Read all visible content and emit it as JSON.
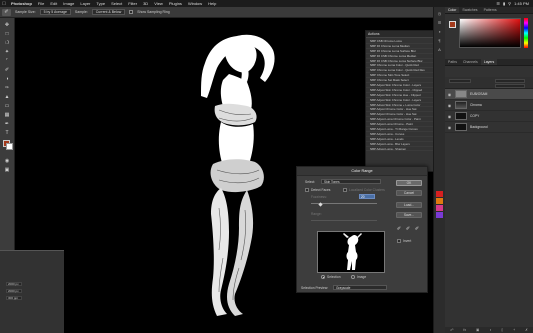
{
  "menubar": {
    "app": "Photoshop",
    "items": [
      "File",
      "Edit",
      "Image",
      "Layer",
      "Type",
      "Select",
      "Filter",
      "3D",
      "View",
      "Plugins",
      "Window",
      "Help"
    ],
    "time": "1:45 PM"
  },
  "options": {
    "sample_size_label": "Sample Size:",
    "sample_size": "5 by 5 Average",
    "sample_label": "Sample:",
    "sample": "Current & Below",
    "show_ring": "Show Sampling Ring"
  },
  "actions": {
    "title": "Actions",
    "items": [
      "NBP CSB Chrome Luma",
      "NBP F6 Chrome Luma Median",
      "NBP F6 Chrome Luma Surface Blur",
      "NBP F6 CSB Chrome Luma Median",
      "NBP F6 CSB Chrome Luma Surface Blur",
      "NBP Chrome Luma Color - Quick Red",
      "NBP Chrome Luma Color - Quick Red Res",
      "NBP Chrome Skin Tone Select",
      "NBP Chrome Set Mask Select",
      "NBP Adjust Skin Chrome Color - Layers",
      "NBP Adjust Skin Chrome Color - Clipped",
      "NBP Adjust Skin Chrome Hue - Clipped",
      "NBP Adjust Skin Chrome Color - Layers",
      "NBP Adjust Skin Chrome + Luma Color",
      "NBP Adjust Chrome Color - Hue Sat",
      "NBP Adjust Chrome Color - Hue Sat",
      "NBP Adjust Luma Chrome Color - Paint",
      "NBP Adjust Luma Chrome - Paint",
      "NBP Adjust Luma - Tri Range Curves",
      "NBP Adjust Luma - Curves",
      "NBP Adjust Luma - Levels",
      "NBP Adjust Luma - Blur Layers",
      "NBP Adjust Luma - Sharpen"
    ]
  },
  "panels": {
    "tabs": [
      "Color",
      "Swatches",
      "Patterns"
    ],
    "layer_tabs": [
      "Paths",
      "Channels",
      "Layers"
    ],
    "layers": [
      {
        "name": "EUB/OSAM"
      },
      {
        "name": "Chroma"
      },
      {
        "name": "COPY"
      },
      {
        "name": "Background"
      }
    ]
  },
  "left_panel": {
    "values": [
      "2000 px",
      "2000 px",
      "300 ppi"
    ]
  },
  "dialog": {
    "title": "Color Range",
    "select_label": "Select:",
    "select_value": "Skin Tones",
    "detect_faces": "Detect Faces",
    "localized": "Localized Color Clusters",
    "fuzziness_label": "Fuzziness:",
    "fuzziness_value": "20",
    "range_label": "Range:",
    "selection": "Selection",
    "image": "Image",
    "preview_label": "Selection Preview:",
    "preview_value": "Grayscale",
    "ok": "OK",
    "cancel": "Cancel",
    "load": "Load...",
    "save": "Save...",
    "invert": "Invert"
  },
  "colors": {
    "foreground": "#a33a1c",
    "background": "#ffffff",
    "accent": "#4a6fa5"
  }
}
